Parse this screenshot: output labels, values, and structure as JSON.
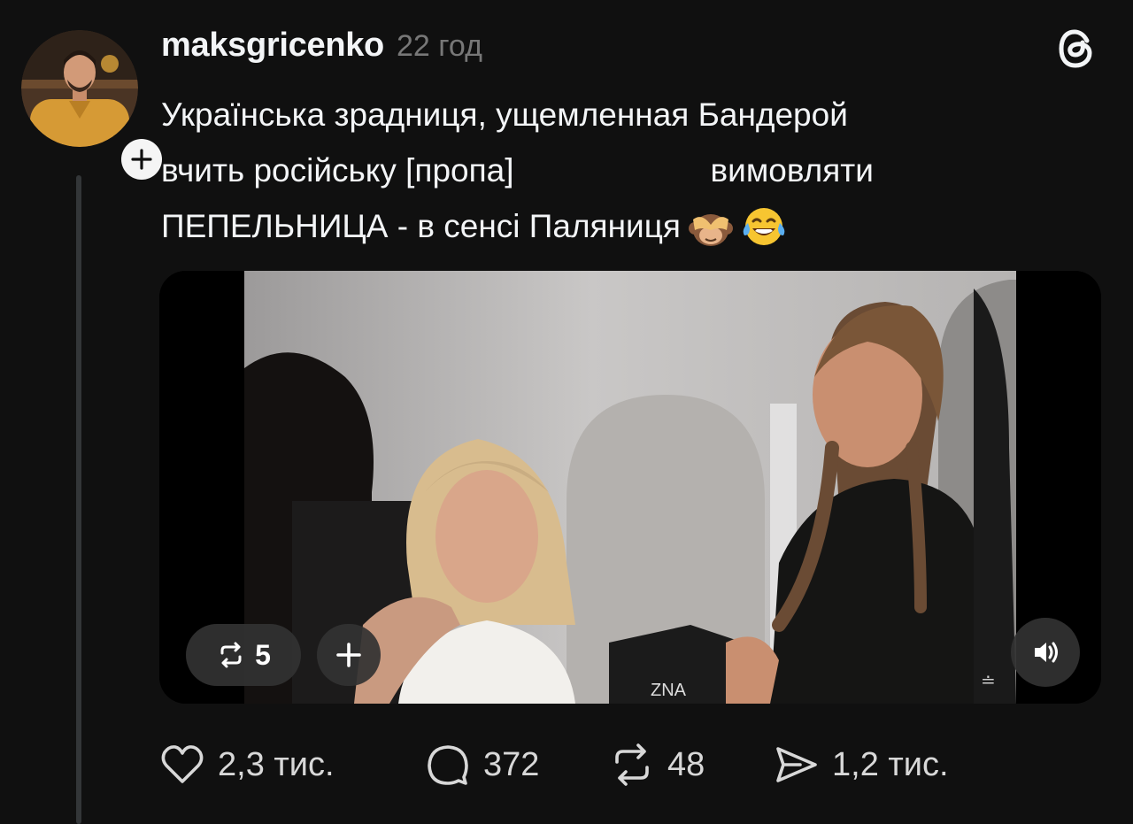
{
  "post": {
    "username": "maksgricenko",
    "timestamp": "22 год",
    "text_line1": "Українська зрадниця, ущемленная Бандерой",
    "text_line2_a": "вчить російську [пропа]",
    "text_line2_b": "вимовляти",
    "text_line3": "ПЕПЕЛЬНИЦА - в сенсі Паляниця",
    "emojis": [
      "see-no-evil-monkey",
      "tears-of-joy"
    ]
  },
  "media": {
    "repost_count": "5",
    "watermark": "≐",
    "bag_text": "ZNA"
  },
  "actions": {
    "likes": "2,3 тис.",
    "comments": "372",
    "reposts": "48",
    "shares": "1,2 тис."
  },
  "icons": {
    "avatar": "avatar-photo",
    "follow": "plus-icon",
    "logo": "threads-logo-icon",
    "like": "heart-icon",
    "comment": "comment-bubble-icon",
    "repost": "repost-arrows-icon",
    "share": "send-icon",
    "sound": "speaker-icon"
  },
  "colors": {
    "background": "#101010",
    "text": "#f3f5f7",
    "muted": "#777777",
    "thread_line": "#333638"
  }
}
